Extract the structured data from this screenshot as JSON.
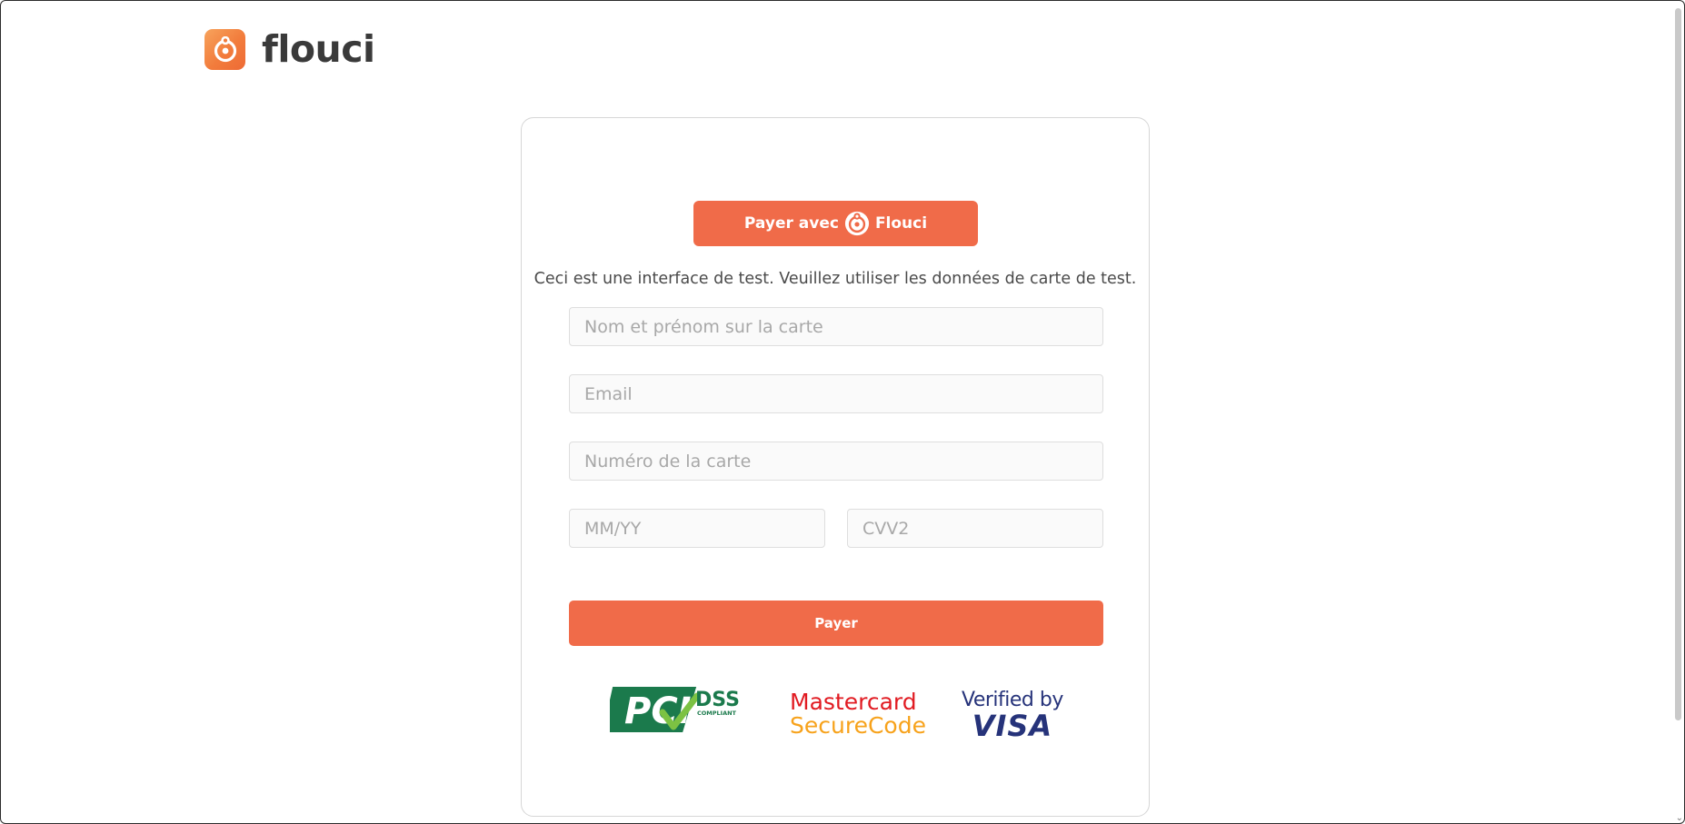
{
  "brand": {
    "name": "flouci",
    "accent_color": "#f06b49",
    "logo_icon": "flouci-logo-icon"
  },
  "payment": {
    "flouci_button": {
      "prefix": "Payer avec",
      "brand": "Flouci",
      "icon": "flouci-logo-icon"
    },
    "notice": "Ceci est une interface de test. Veuillez utiliser les données de carte de test.",
    "fields": {
      "name": {
        "value": "",
        "placeholder": "Nom et prénom sur la carte"
      },
      "email": {
        "value": "",
        "placeholder": "Email"
      },
      "card_number": {
        "value": "",
        "placeholder": "Numéro de la carte"
      },
      "expiry": {
        "value": "",
        "placeholder": "MM/YY"
      },
      "cvv": {
        "value": "",
        "placeholder": "CVV2"
      }
    },
    "pay_button": "Payer"
  },
  "badges": {
    "pci": {
      "main": "PCI",
      "sub1": "DSS",
      "sub2": "COMPLIANT"
    },
    "mastercard": {
      "line1": "Mastercard",
      "line2": "SecureCode"
    },
    "visa": {
      "line1": "Verified by",
      "line2": "VISA"
    }
  }
}
